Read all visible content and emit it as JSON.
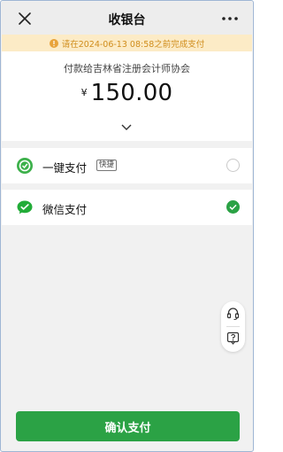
{
  "header": {
    "title": "收银台",
    "close_icon": "close-icon",
    "more_icon": "more-icon"
  },
  "notice": {
    "text": "请在2024-06-13 08:58之前完成支付",
    "icon": "warning-icon",
    "color": "#d08d1c",
    "background": "#fcebc6"
  },
  "payment": {
    "payee": "付款给吉林省注册会计师协会",
    "currency": "¥",
    "amount": "150.00",
    "expand_icon": "chevron-down-icon"
  },
  "options": [
    {
      "label": "一键支付",
      "tag": "快捷",
      "icon": "one-click-pay-icon",
      "selected": false
    },
    {
      "label": "微信支付",
      "icon": "wechat-pay-icon",
      "selected": true
    }
  ],
  "helper": {
    "service_icon": "headset-icon",
    "faq_icon": "help-icon"
  },
  "confirm_button": {
    "label": "确认支付",
    "color": "#2ba245"
  }
}
